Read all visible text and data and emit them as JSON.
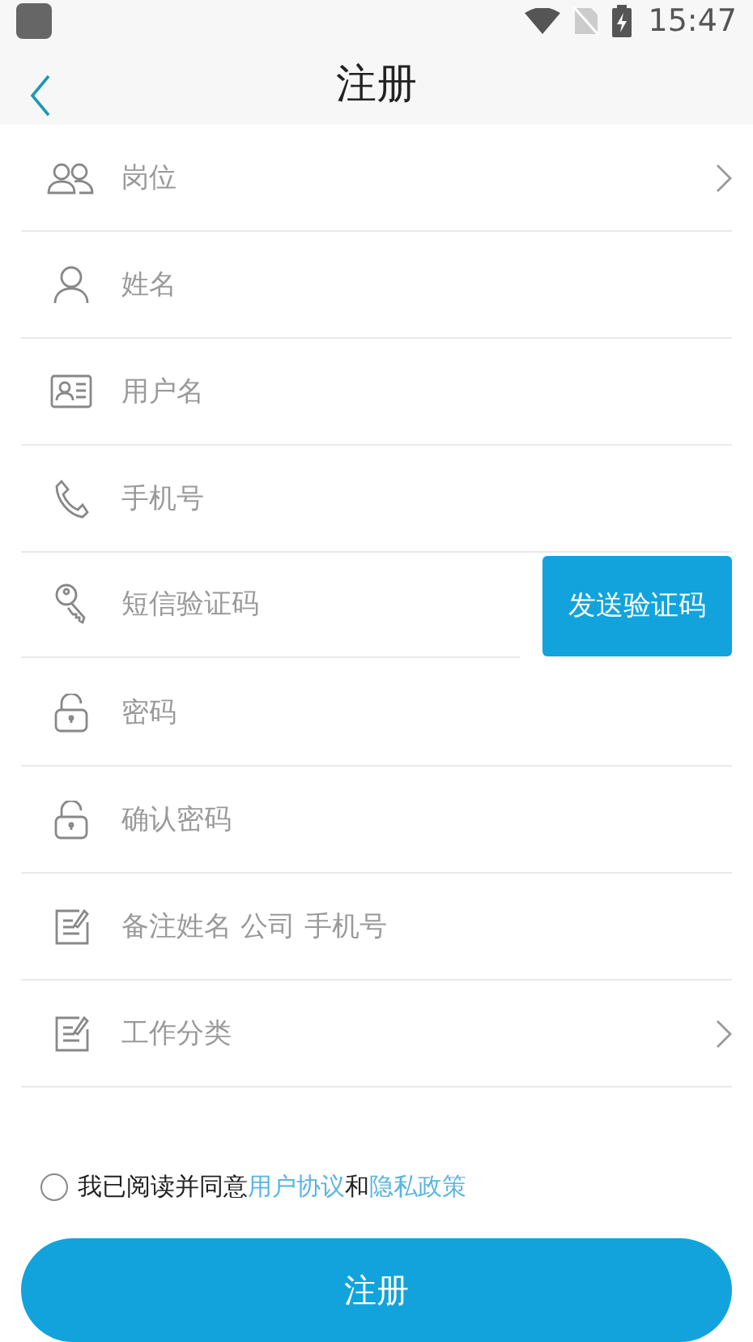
{
  "status_bar": {
    "time": "15:47"
  },
  "header": {
    "title": "注册"
  },
  "fields": [
    {
      "kind": "select",
      "placeholder": "岗位"
    },
    {
      "kind": "input",
      "placeholder": "姓名"
    },
    {
      "kind": "input",
      "placeholder": "用户名"
    },
    {
      "kind": "input",
      "placeholder": "手机号"
    },
    {
      "kind": "sms",
      "placeholder": "短信验证码",
      "button": "发送验证码"
    },
    {
      "kind": "password",
      "placeholder": "密码"
    },
    {
      "kind": "password",
      "placeholder": "确认密码"
    },
    {
      "kind": "input",
      "placeholder": "备注姓名 公司 手机号"
    },
    {
      "kind": "select",
      "placeholder": "工作分类"
    }
  ],
  "agreement": {
    "checked": false,
    "prefix": "我已阅读并同意",
    "link_1": "用户协议",
    "joiner": "和",
    "link_2": "隐私政策"
  },
  "submit": "注册"
}
